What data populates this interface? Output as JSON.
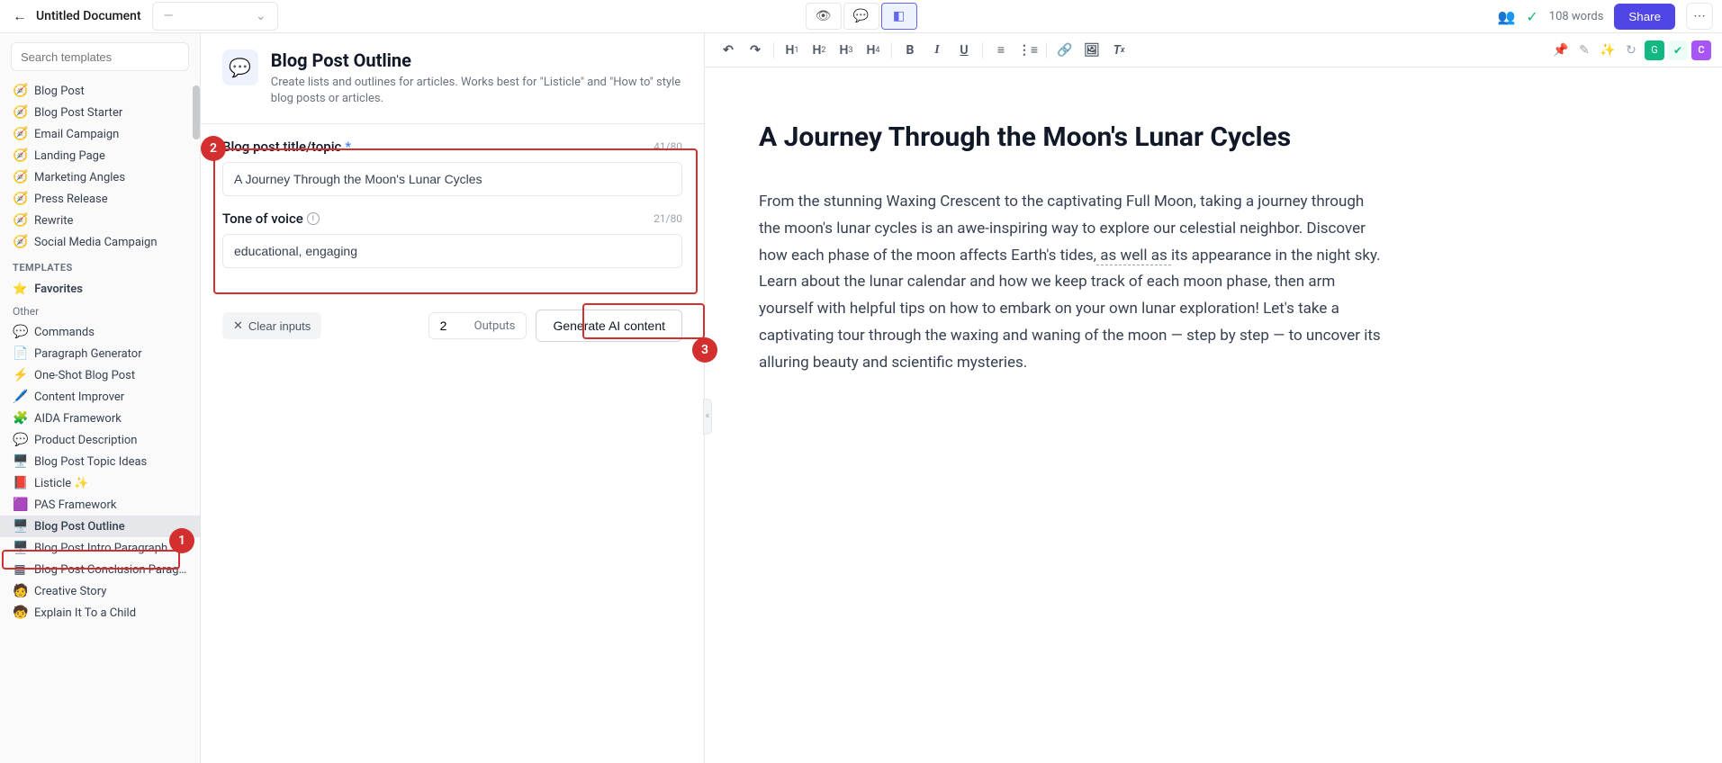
{
  "header": {
    "doc_title": "Untitled Document",
    "dropdown_label": "—",
    "word_count": "108 words",
    "share_label": "Share"
  },
  "sidebar": {
    "search_placeholder": "Search templates",
    "top_items": [
      {
        "icon": "🧭",
        "label": "Blog Post"
      },
      {
        "icon": "🧭",
        "label": "Blog Post Starter"
      },
      {
        "icon": "🧭",
        "label": "Email Campaign"
      },
      {
        "icon": "🧭",
        "label": "Landing Page"
      },
      {
        "icon": "🧭",
        "label": "Marketing Angles"
      },
      {
        "icon": "🧭",
        "label": "Press Release"
      },
      {
        "icon": "🧭",
        "label": "Rewrite"
      },
      {
        "icon": "🧭",
        "label": "Social Media Campaign"
      }
    ],
    "templates_header": "TEMPLATES",
    "favorites_label": "Favorites",
    "other_label": "Other",
    "other_items": [
      {
        "icon": "💬",
        "label": "Commands"
      },
      {
        "icon": "📄",
        "label": "Paragraph Generator"
      },
      {
        "icon": "⚡",
        "label": "One-Shot Blog Post"
      },
      {
        "icon": "🖊️",
        "label": "Content Improver"
      },
      {
        "icon": "🧩",
        "label": "AIDA Framework"
      },
      {
        "icon": "💬",
        "label": "Product Description"
      },
      {
        "icon": "🖥️",
        "label": "Blog Post Topic Ideas"
      },
      {
        "icon": "📕",
        "label": "Listicle ✨"
      },
      {
        "icon": "🟪",
        "label": "PAS Framework"
      },
      {
        "icon": "🖥️",
        "label": "Blog Post Outline"
      },
      {
        "icon": "🖥️",
        "label": "Blog Post Intro Paragraph"
      },
      {
        "icon": "▦",
        "label": "Blog Post Conclusion Parag…"
      },
      {
        "icon": "🧑",
        "label": "Creative Story"
      },
      {
        "icon": "🧒",
        "label": "Explain It To a Child"
      }
    ]
  },
  "form": {
    "title": "Blog Post Outline",
    "desc": "Create lists and outlines for articles. Works best for \"Listicle\" and \"How to\" style blog posts or articles.",
    "field1_label": "Blog post title/topic",
    "field1_count": "41/80",
    "field1_value": "A Journey Through the Moon's Lunar Cycles",
    "field2_label": "Tone of voice",
    "field2_count": "21/80",
    "field2_value": "educational, engaging",
    "clear_label": "Clear inputs",
    "outputs_value": "2",
    "outputs_label": "Outputs",
    "generate_label": "Generate AI content"
  },
  "callouts": {
    "c1": "1",
    "c2": "2",
    "c3": "3"
  },
  "document": {
    "h1": "A Journey Through the Moon's Lunar Cycles",
    "p_before": "From the stunning Waxing Crescent to the captivating Full Moon, taking a journey through the moon's lunar cycles is an awe-inspiring way to explore our celestial neighbor. Discover how each phase of the moon affects Earth's tides,",
    "p_underline": " as well as ",
    "p_after": "its appearance in the night sky. Learn about the lunar calendar and how we keep track of each moon phase, then arm yourself with helpful tips on how to embark on your own lunar exploration! Let's take a captivating tour through the waxing and waning of the moon — step by step — to uncover its alluring beauty and scientific mysteries."
  },
  "toolbar": {
    "h1": "H",
    "h2": "H",
    "h3": "H",
    "h4": "H",
    "bold": "B",
    "italic": "I",
    "underline": "U",
    "avatar_initial": "C"
  }
}
